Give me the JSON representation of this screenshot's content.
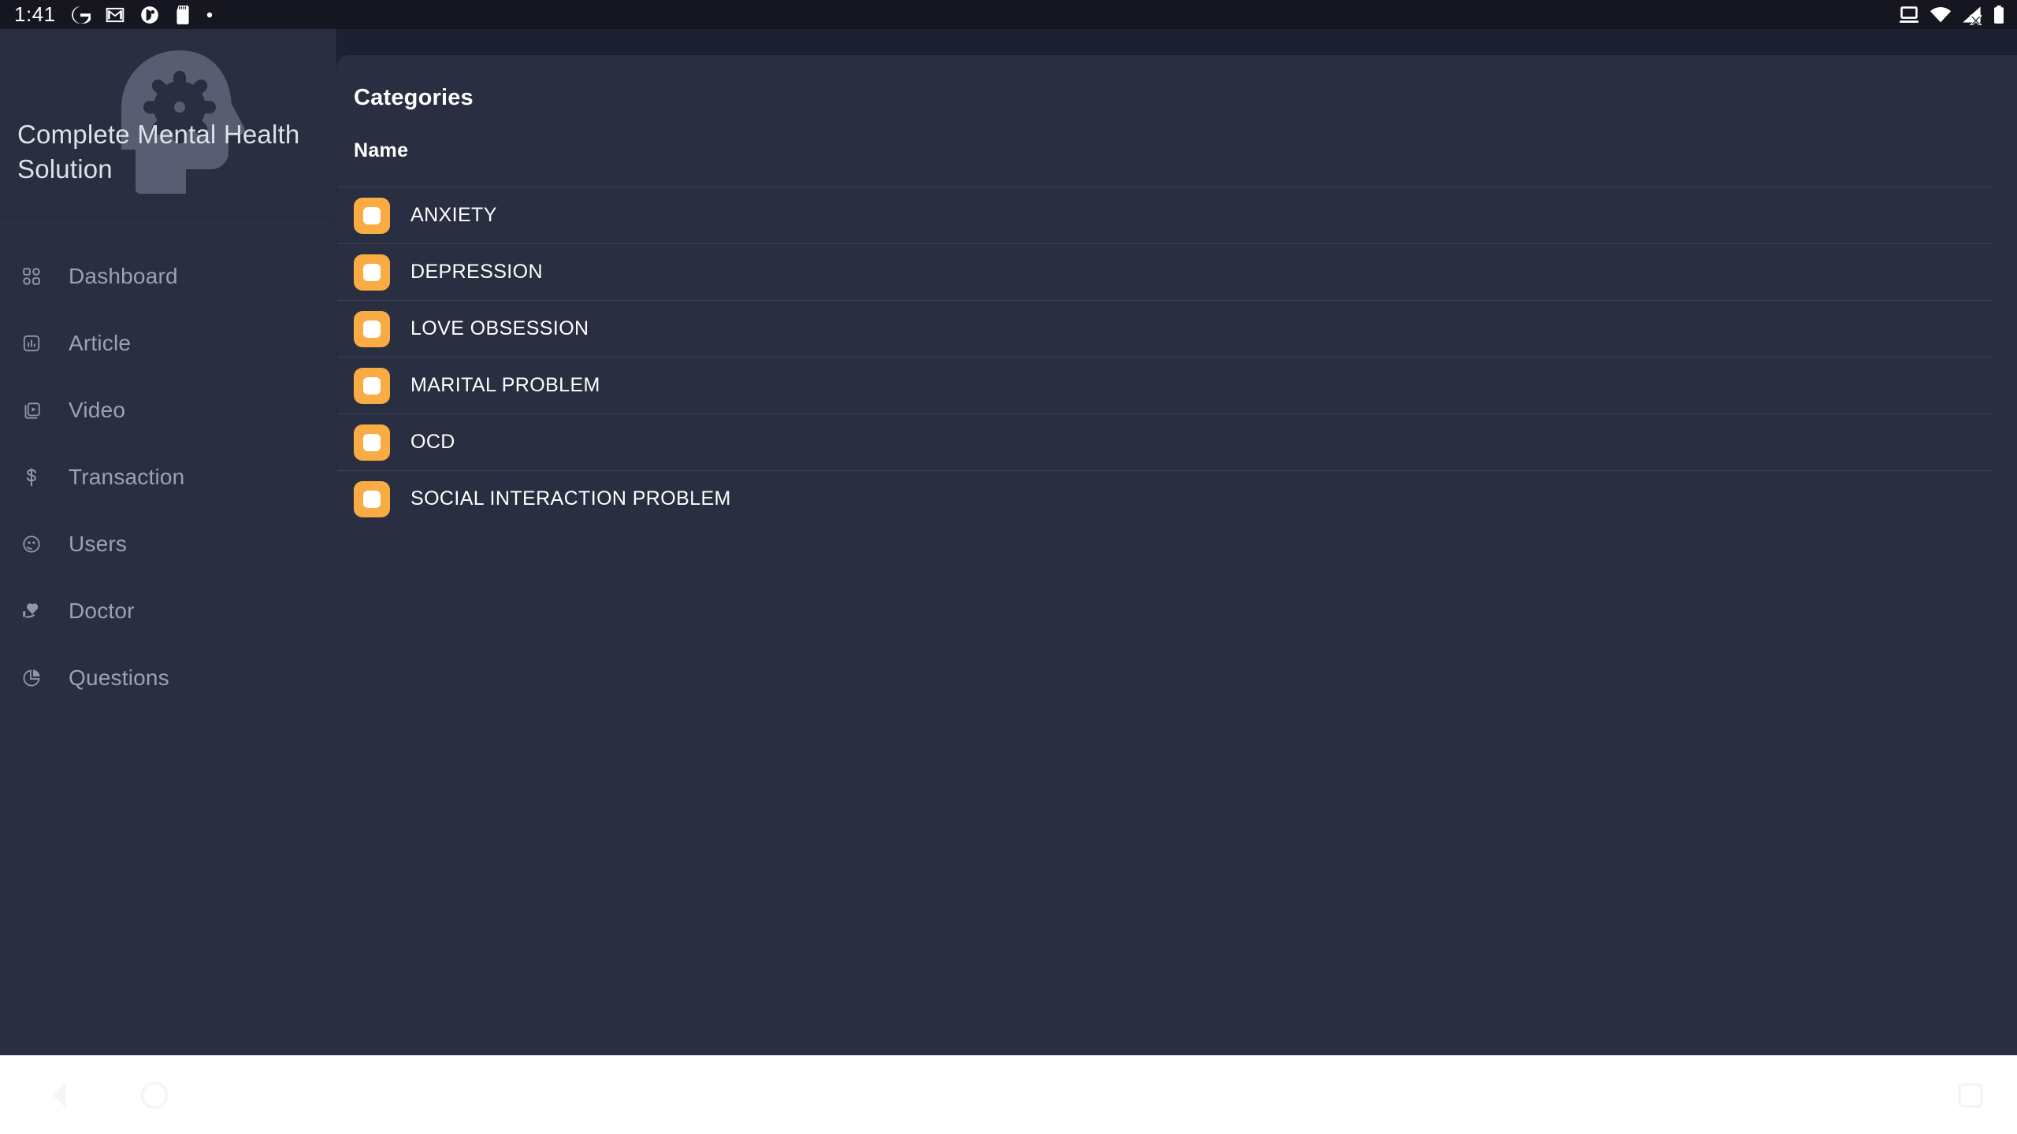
{
  "statusbar": {
    "clock": "1:41",
    "left_icons": [
      "google-icon",
      "gmail-icon",
      "app-circle-icon",
      "sd-card-icon",
      "dot-icon"
    ],
    "right_icons": [
      "cast-screen-icon",
      "wifi-icon",
      "signal-no-sim-icon",
      "battery-icon"
    ]
  },
  "sidebar": {
    "logo": {
      "icon": "head-gear-brain-icon",
      "title": "Complete Mental Health Solution"
    },
    "items": [
      {
        "label": "Dashboard",
        "icon": "grid-icon"
      },
      {
        "label": "Article",
        "icon": "article-chart-icon"
      },
      {
        "label": "Video",
        "icon": "video-stack-icon"
      },
      {
        "label": "Transaction",
        "icon": "dollar-icon"
      },
      {
        "label": "Users",
        "icon": "users-face-icon"
      },
      {
        "label": "Doctor",
        "icon": "hand-heart-icon"
      },
      {
        "label": "Questions",
        "icon": "pie-chart-icon"
      }
    ]
  },
  "main": {
    "page_title": "Categories",
    "columns": [
      "Name"
    ],
    "rows": [
      {
        "name": "ANXIETY",
        "icon": "stop-square-icon"
      },
      {
        "name": "DEPRESSION",
        "icon": "stop-square-icon"
      },
      {
        "name": "LOVE OBSESSION",
        "icon": "stop-square-icon"
      },
      {
        "name": "MARITAL PROBLEM",
        "icon": "stop-square-icon"
      },
      {
        "name": "OCD",
        "icon": "stop-square-icon"
      },
      {
        "name": "SOCIAL INTERACTION PROBLEM",
        "icon": "stop-square-icon"
      }
    ]
  },
  "navbar": {
    "back": "back-icon",
    "home": "home-icon",
    "recents": "recents-icon"
  },
  "colors": {
    "accent": "#f9ac44",
    "sidebar_bg": "#2a2e41",
    "content_bg": "#2a2e41",
    "statusbar_bg": "#15161f",
    "divider": "#3b4055",
    "text_primary": "#ffffff",
    "text_muted": "#9da1b4"
  }
}
